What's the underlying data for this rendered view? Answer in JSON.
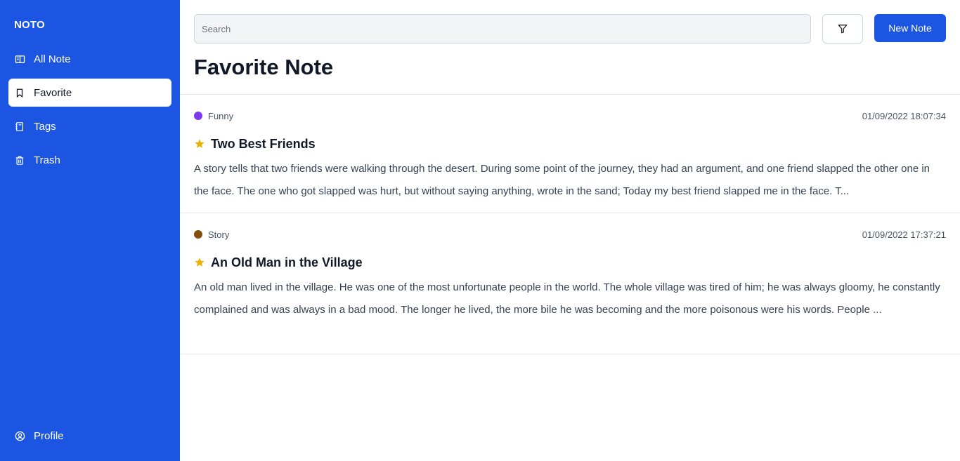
{
  "sidebar": {
    "brand": "NOTO",
    "items": [
      {
        "label": "All Note",
        "icon": "book-icon"
      },
      {
        "label": "Favorite",
        "icon": "bookmark-icon",
        "active": true
      },
      {
        "label": "Tags",
        "icon": "notebook-icon"
      },
      {
        "label": "Trash",
        "icon": "trash-icon"
      }
    ],
    "profile": {
      "label": "Profile",
      "icon": "user-circle-icon"
    }
  },
  "toolbar": {
    "search_placeholder": "Search",
    "search_value": "",
    "filter_icon": "filter-icon",
    "new_note_label": "New Note"
  },
  "page": {
    "title": "Favorite Note"
  },
  "notes": [
    {
      "tag": "Funny",
      "tag_color": "#7c3aed",
      "timestamp": "01/09/2022 18:07:34",
      "favorite": true,
      "title": "Two Best Friends",
      "excerpt": "A story tells that two friends were walking through the desert. During some point of the journey, they had an argument, and one friend slapped the other one in the face. The one who got slapped was hurt, but without saying anything, wrote in the sand; Today my best friend slapped me in the face. T..."
    },
    {
      "tag": "Story",
      "tag_color": "#854d0e",
      "timestamp": "01/09/2022 17:37:21",
      "favorite": true,
      "title": "An Old Man in the Village",
      "excerpt": "An old man lived in the village. He was one of the most unfortunate people in the world. The whole village was tired of him; he was always gloomy, he constantly complained and was always in a bad mood. The longer he lived, the more bile he was becoming and the more poisonous were his words. People ..."
    }
  ],
  "colors": {
    "brand": "#1b55e2",
    "star": "#eab308"
  }
}
